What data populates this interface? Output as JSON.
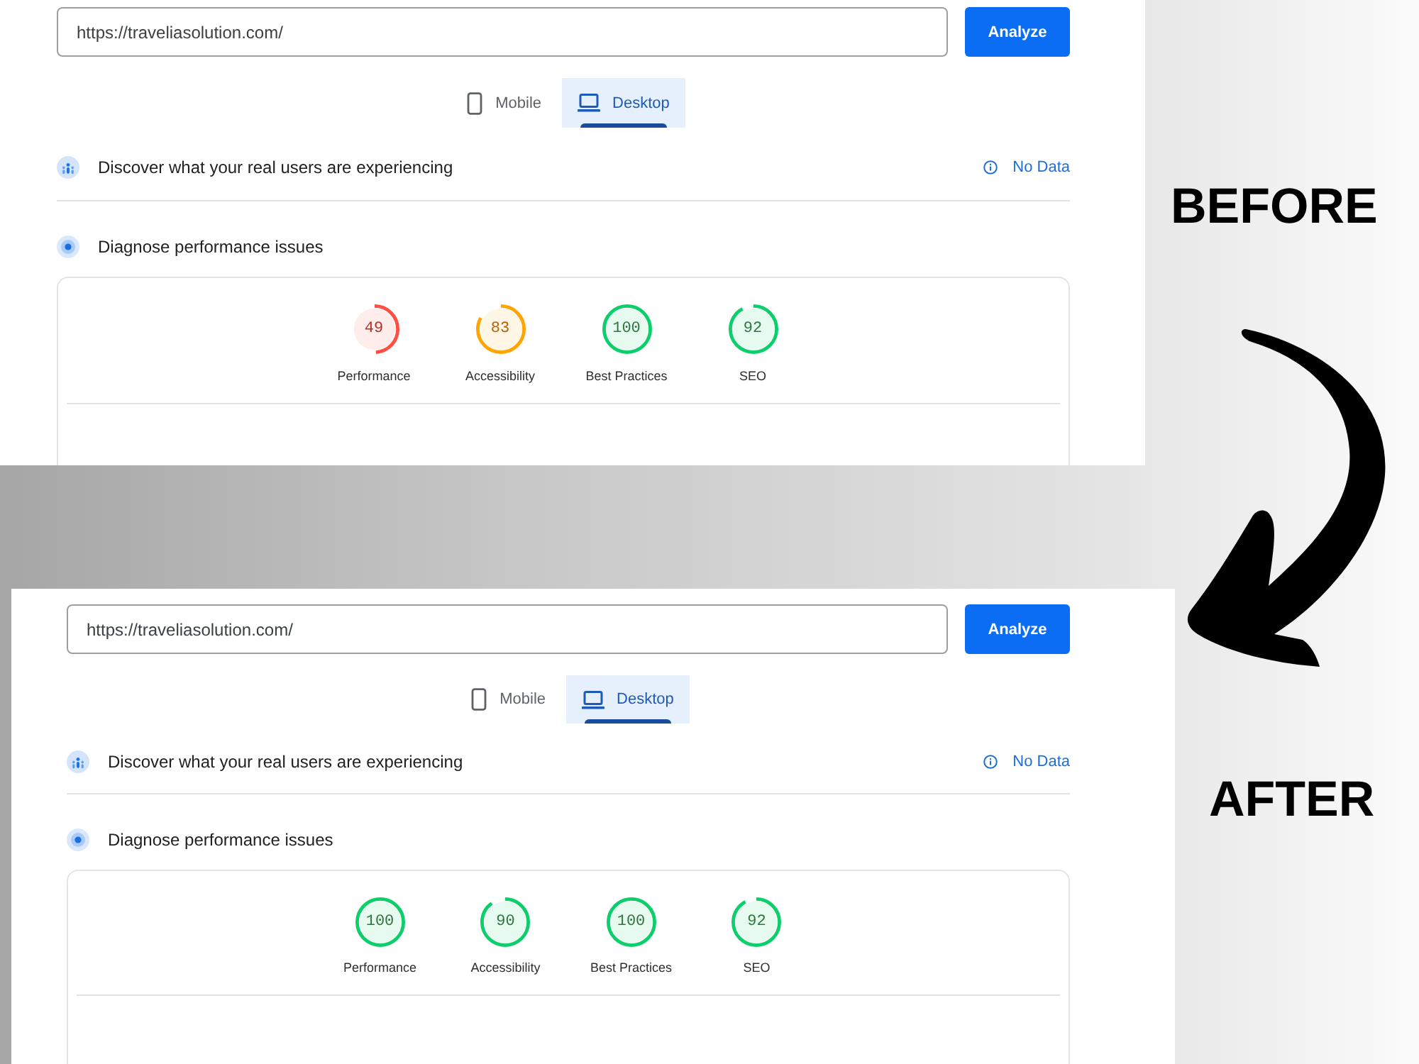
{
  "panels": [
    {
      "url": "https://traveliasolution.com/",
      "analyze_button": "Analyze",
      "tabs": [
        {
          "label": "Mobile",
          "selected": false
        },
        {
          "label": "Desktop",
          "selected": true
        }
      ],
      "field_data": {
        "title": "Discover what your real users are experiencing",
        "status": "No Data"
      },
      "diagnose": {
        "title": "Diagnose performance issues"
      },
      "scores": [
        {
          "value": "49",
          "label": "Performance",
          "level": 0.49,
          "color": "#ff4e42"
        },
        {
          "value": "83",
          "label": "Accessibility",
          "level": 0.83,
          "color": "#ffa400"
        },
        {
          "value": "100",
          "label": "Best Practices",
          "level": 1,
          "color": "#0cce6b"
        },
        {
          "value": "92",
          "label": "SEO",
          "level": 0.92,
          "color": "#0cce6b"
        }
      ],
      "caption": "BEFORE"
    },
    {
      "url": "https://traveliasolution.com/",
      "analyze_button": "Analyze",
      "tabs": [
        {
          "label": "Mobile",
          "selected": false
        },
        {
          "label": "Desktop",
          "selected": true
        }
      ],
      "field_data": {
        "title": "Discover what your real users are experiencing",
        "status": "No Data"
      },
      "diagnose": {
        "title": "Diagnose performance issues"
      },
      "scores": [
        {
          "value": "100",
          "label": "Performance",
          "level": 1,
          "color": "#0cce6b"
        },
        {
          "value": "90",
          "label": "Accessibility",
          "level": 0.9,
          "color": "#0cce6b"
        },
        {
          "value": "100",
          "label": "Best Practices",
          "level": 1,
          "color": "#0cce6b"
        },
        {
          "value": "92",
          "label": "SEO",
          "level": 0.92,
          "color": "#0cce6b"
        }
      ],
      "caption": "AFTER"
    }
  ]
}
